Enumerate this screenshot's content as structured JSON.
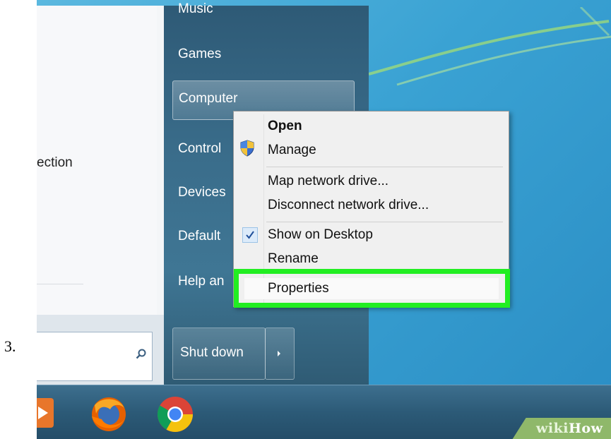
{
  "step_number": "3.",
  "left_panel": {
    "connection_label": "ection",
    "search": {
      "value": "",
      "icon": "search-icon"
    }
  },
  "start_menu_right": {
    "items": [
      {
        "label": "Music"
      },
      {
        "label": "Games"
      },
      {
        "label": "Computer"
      },
      {
        "label": "Control"
      },
      {
        "label": "Devices"
      },
      {
        "label": "Default"
      },
      {
        "label": "Help an"
      }
    ],
    "shutdown_label": "Shut down"
  },
  "context_menu": {
    "items": [
      {
        "label": "Open"
      },
      {
        "label": "Manage"
      },
      {
        "label": "Map network drive..."
      },
      {
        "label": "Disconnect network drive..."
      },
      {
        "label": "Show on Desktop"
      },
      {
        "label": "Rename"
      },
      {
        "label": "Properties"
      }
    ],
    "highlight_color": "#22ee22"
  },
  "taskbar": {
    "icons": [
      "media-player-icon",
      "firefox-icon",
      "chrome-icon"
    ]
  },
  "watermark": {
    "prefix": "wiki",
    "suffix": "How"
  }
}
